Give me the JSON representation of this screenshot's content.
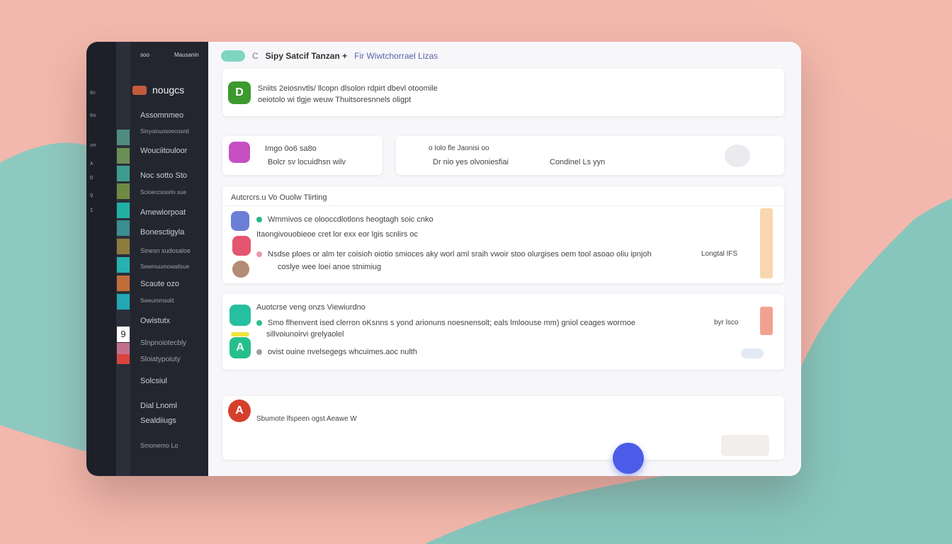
{
  "topbar": {
    "back_label": "C",
    "title": "Sipy Satcif Tanzan +",
    "subtitle": "Fir Wiwtchorrael Lizas"
  },
  "rail": {
    "labels": [
      "0c",
      "0o",
      "on",
      "A",
      "D",
      "g",
      "I"
    ]
  },
  "sidebar": {
    "header_left": "soo",
    "header_right": "Mausanin",
    "brand": "nougcs",
    "items": [
      "Assomnmeo",
      "Sinyoiouosoecosnit",
      "Wouciitouloor",
      "Noc sotto  Sto",
      "Scioeccsoorlo sue",
      "Amewiorpoat",
      "Bonesctigyla",
      "Sinesn sudosaloe",
      "Sewmuumowaitsue",
      "Scaute  ozo",
      "Sweummsolit",
      "Owistutx",
      "Slnpnoiotecbly",
      "Sloiatypoiuty",
      "Solcsiul",
      "Dial Lnoml",
      "Sealdiiugs",
      "Smonemo  Lo"
    ],
    "badge": "9"
  },
  "cards": {
    "card1": {
      "line1": "Sniits 2eiosnvtls/ llcopn dlsolon rdpirt dbevl otoomile",
      "line2": "oeiotolo wi tlgje weuw Thuitsoresnnels oligpt"
    },
    "card2": {
      "line1": "Imgo 0o6 sa8o",
      "line2": "Bolcr sv locuidhsn  wilv"
    },
    "card3": {
      "line1": "o Iolo  fle Jaonisi oo",
      "line2": "Dr nio yes olvoniesfiai",
      "line3": "Condinel  Ls yyn"
    },
    "card4": {
      "heading": "Autcrcrs.u  Vo  Ouolw Tlirting",
      "row1": "Wmmivos ce olooccdlotlons heogtagh soic cnko",
      "row2": "Itaongivouobieoe cret lor exx eor lgis scnlirs oc",
      "row3": "Nsdse ploes or alm ter coisioh oiotio smioces aky worl aml sraih vwoir stoo olurgises oem tool asoao oliu ipnjoh",
      "row3_side": "Longtal  IFS",
      "row4": "coslye  wee loei anoe stnimiug"
    },
    "card5": {
      "heading": "Auotcrse veng onzs Viewiurdno",
      "row1": "Smo flhenvent ised clerron oKsnns s yond arionuns noesnensolt; eals lmloouse mm) gniol ceages worrnoe",
      "row1_side": "byr lsco",
      "row2": "sillvoiunoirvi grelyaolel",
      "row3": "ovist ouine nvelsegegs whcuimes.aoc nulth"
    },
    "card6": {
      "line1": "Sbumote lfspeen ogst Aeawe W"
    }
  },
  "colors": {
    "accent_green": "#7fd6bf",
    "fab_blue": "#4b5de8",
    "dark_sidebar": "#23262f",
    "background_pink": "#f2b8ad",
    "background_teal": "#7fc4bb"
  },
  "icons": {
    "card1": "D",
    "card5b": "A",
    "card6": "A"
  }
}
